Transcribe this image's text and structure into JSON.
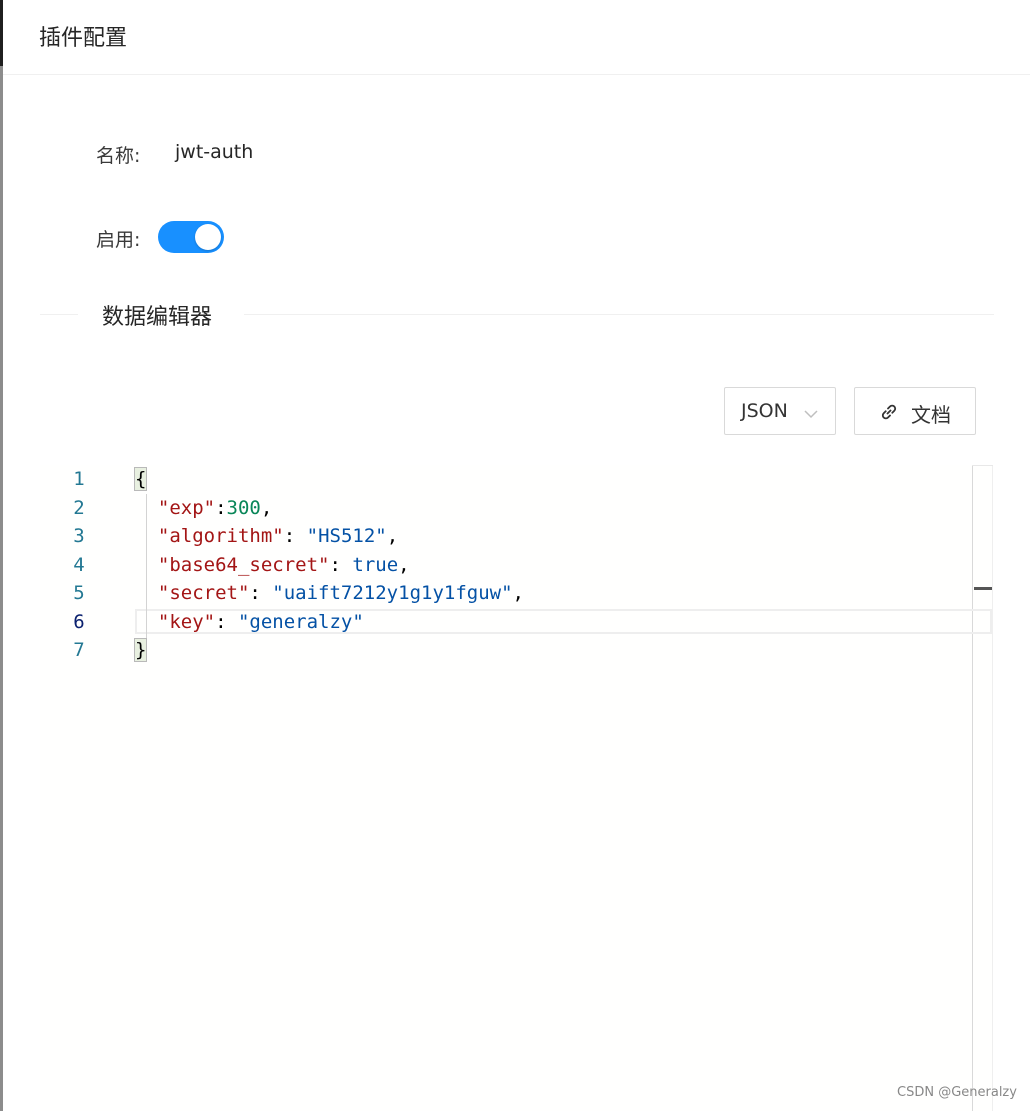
{
  "header": {
    "title": "插件配置"
  },
  "form": {
    "name_label": "名称:",
    "name_value": "jwt-auth",
    "enable_label": "启用:",
    "enabled": true
  },
  "divider": {
    "label": "数据编辑器"
  },
  "toolbar": {
    "format_select": {
      "value": "JSON"
    },
    "doc_button": {
      "label": "文档",
      "icon": "link-icon"
    }
  },
  "editor": {
    "current_line": 6,
    "lines": [
      {
        "num": "1",
        "tokens": [
          [
            "bracket",
            "{"
          ]
        ]
      },
      {
        "num": "2",
        "tokens": [
          [
            "punc",
            "  "
          ],
          [
            "key",
            "\"exp\""
          ],
          [
            "punc",
            ":"
          ],
          [
            "num",
            "300"
          ],
          [
            "punc",
            ","
          ]
        ]
      },
      {
        "num": "3",
        "tokens": [
          [
            "punc",
            "  "
          ],
          [
            "key",
            "\"algorithm\""
          ],
          [
            "punc",
            ": "
          ],
          [
            "str",
            "\"HS512\""
          ],
          [
            "punc",
            ","
          ]
        ]
      },
      {
        "num": "4",
        "tokens": [
          [
            "punc",
            "  "
          ],
          [
            "key",
            "\"base64_secret\""
          ],
          [
            "punc",
            ": "
          ],
          [
            "bool",
            "true"
          ],
          [
            "punc",
            ","
          ]
        ]
      },
      {
        "num": "5",
        "tokens": [
          [
            "punc",
            "  "
          ],
          [
            "key",
            "\"secret\""
          ],
          [
            "punc",
            ": "
          ],
          [
            "str",
            "\"uaift7212y1g1y1fguw\""
          ],
          [
            "punc",
            ","
          ]
        ]
      },
      {
        "num": "6",
        "tokens": [
          [
            "punc",
            "  "
          ],
          [
            "key",
            "\"key\""
          ],
          [
            "punc",
            ": "
          ],
          [
            "str",
            "\"generalzy\""
          ]
        ]
      },
      {
        "num": "7",
        "tokens": [
          [
            "bracket",
            "}"
          ]
        ]
      }
    ]
  },
  "colors": {
    "accent": "#1890ff",
    "json_key": "#a31515",
    "json_string": "#0451a5",
    "json_number": "#098658",
    "line_number": "#237893"
  },
  "watermark": "CSDN @Generalzy"
}
